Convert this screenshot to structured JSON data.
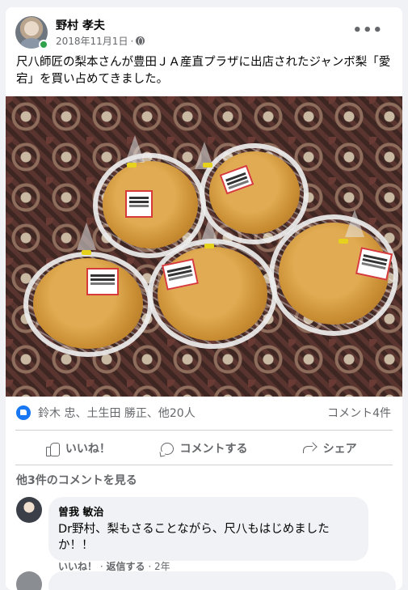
{
  "post": {
    "author": "野村 孝夫",
    "date": "2018年11月1日",
    "separator": "·",
    "text": "尺八師匠の梨本さんが豊田ＪＡ産直プラザに出店されたジャンボ梨「愛宕」を買い占めてきました。"
  },
  "reactions": {
    "names": "鈴木 忠、土生田 勝正、他20人",
    "comment_count": "コメント4件"
  },
  "actions": {
    "like": "いいね！",
    "comment": "コメントする",
    "share": "シェア"
  },
  "comments": {
    "view_more": "他3件のコメントを見る",
    "items": [
      {
        "author": "曽我 敏治",
        "text": "Dr野村、梨もさることながら、尺八もはじめましたか！！",
        "like": "いいね！",
        "reply": "返信する",
        "time": "2年",
        "dot": "·"
      }
    ]
  },
  "icons": {
    "more": "more-icon",
    "globe": "globe-icon",
    "like": "thumb-icon",
    "comment": "comment-icon",
    "share": "share-icon"
  },
  "colors": {
    "accent": "#1877f2",
    "online": "#31a24c",
    "muted": "#65676b"
  }
}
